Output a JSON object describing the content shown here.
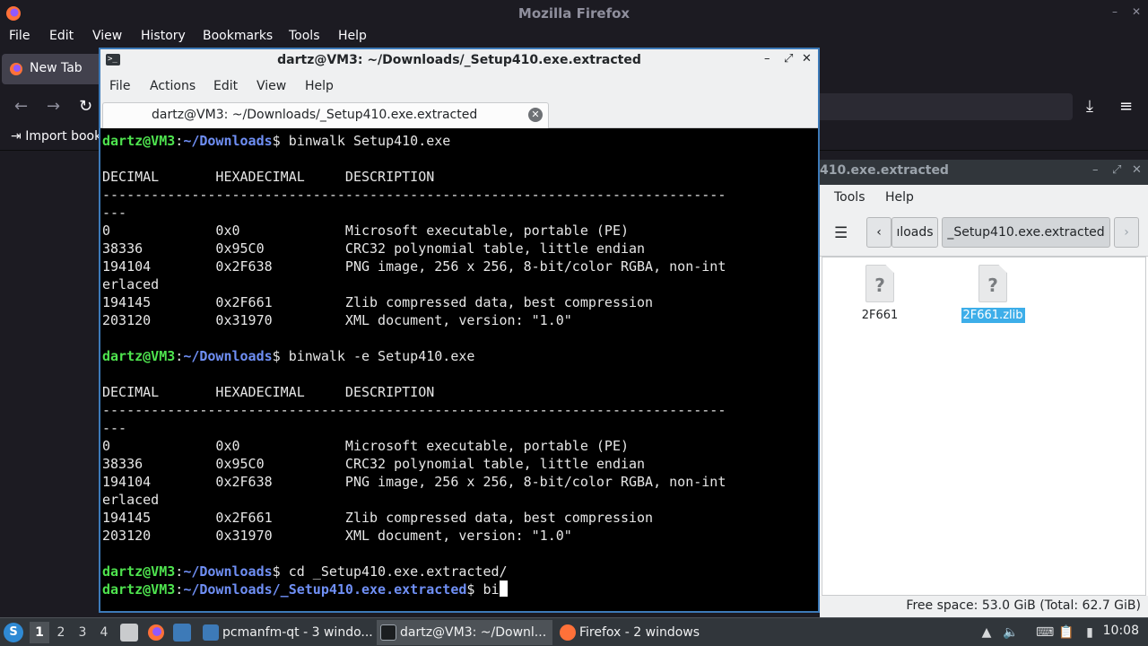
{
  "firefox": {
    "title": "Mozilla Firefox",
    "menu": [
      "File",
      "Edit",
      "View",
      "History",
      "Bookmarks",
      "Tools",
      "Help"
    ],
    "tab_label": "New Tab",
    "bookmarks_item": "Import book"
  },
  "filemanager": {
    "title": "410.exe.extracted",
    "menu": [
      "Tools",
      "Help"
    ],
    "path_parent": "ıloads",
    "path_current": "_Setup410.exe.extracted",
    "files": [
      {
        "name": "2F661",
        "selected": false
      },
      {
        "name": "2F661.zlib",
        "selected": true
      }
    ],
    "status": "Free space: 53.0 GiB (Total: 62.7 GiB)"
  },
  "terminal": {
    "title": "dartz@VM3: ~/Downloads/_Setup410.exe.extracted",
    "menu": [
      "File",
      "Actions",
      "Edit",
      "View",
      "Help"
    ],
    "tab_label": "dartz@VM3: ~/Downloads/_Setup410.exe.extracted",
    "prompt_user": "dartz@VM3",
    "lines": [
      {
        "kind": "prompt",
        "path": "~/Downloads",
        "cmd": " binwalk Setup410.exe"
      },
      {
        "kind": "out",
        "text": ""
      },
      {
        "kind": "out",
        "text": "DECIMAL       HEXADECIMAL     DESCRIPTION"
      },
      {
        "kind": "out",
        "text": "-----------------------------------------------------------------------------"
      },
      {
        "kind": "out",
        "text": "---"
      },
      {
        "kind": "out",
        "text": "0             0x0             Microsoft executable, portable (PE)"
      },
      {
        "kind": "out",
        "text": "38336         0x95C0          CRC32 polynomial table, little endian"
      },
      {
        "kind": "out",
        "text": "194104        0x2F638         PNG image, 256 x 256, 8-bit/color RGBA, non-int"
      },
      {
        "kind": "out",
        "text": "erlaced"
      },
      {
        "kind": "out",
        "text": "194145        0x2F661         Zlib compressed data, best compression"
      },
      {
        "kind": "out",
        "text": "203120        0x31970         XML document, version: \"1.0\""
      },
      {
        "kind": "out",
        "text": ""
      },
      {
        "kind": "prompt",
        "path": "~/Downloads",
        "cmd": " binwalk -e Setup410.exe"
      },
      {
        "kind": "out",
        "text": ""
      },
      {
        "kind": "out",
        "text": "DECIMAL       HEXADECIMAL     DESCRIPTION"
      },
      {
        "kind": "out",
        "text": "-----------------------------------------------------------------------------"
      },
      {
        "kind": "out",
        "text": "---"
      },
      {
        "kind": "out",
        "text": "0             0x0             Microsoft executable, portable (PE)"
      },
      {
        "kind": "out",
        "text": "38336         0x95C0          CRC32 polynomial table, little endian"
      },
      {
        "kind": "out",
        "text": "194104        0x2F638         PNG image, 256 x 256, 8-bit/color RGBA, non-int"
      },
      {
        "kind": "out",
        "text": "erlaced"
      },
      {
        "kind": "out",
        "text": "194145        0x2F661         Zlib compressed data, best compression"
      },
      {
        "kind": "out",
        "text": "203120        0x31970         XML document, version: \"1.0\""
      },
      {
        "kind": "out",
        "text": ""
      },
      {
        "kind": "prompt",
        "path": "~/Downloads",
        "cmd": " cd _Setup410.exe.extracted/"
      },
      {
        "kind": "prompt",
        "path": "~/Downloads/_Setup410.exe.extracted",
        "cmd": " bi",
        "cursor": true
      }
    ]
  },
  "taskbar": {
    "workspaces": [
      "1",
      "2",
      "3",
      "4"
    ],
    "active_workspace": "1",
    "tasks": [
      {
        "label": "pcmanfm-qt - 3 windo...",
        "icon": "folder-icon",
        "active": false
      },
      {
        "label": "dartz@VM3: ~/Downl...",
        "icon": "terminal-icon",
        "active": true
      },
      {
        "label": "Firefox - 2 windows",
        "icon": "firefox-icon",
        "active": false
      }
    ],
    "clock": "10:08"
  },
  "colors": {
    "prompt_user": "#4ee34e",
    "prompt_path": "#6f8ff5",
    "selection": "#3daee9",
    "taskbar": "#31363b"
  }
}
